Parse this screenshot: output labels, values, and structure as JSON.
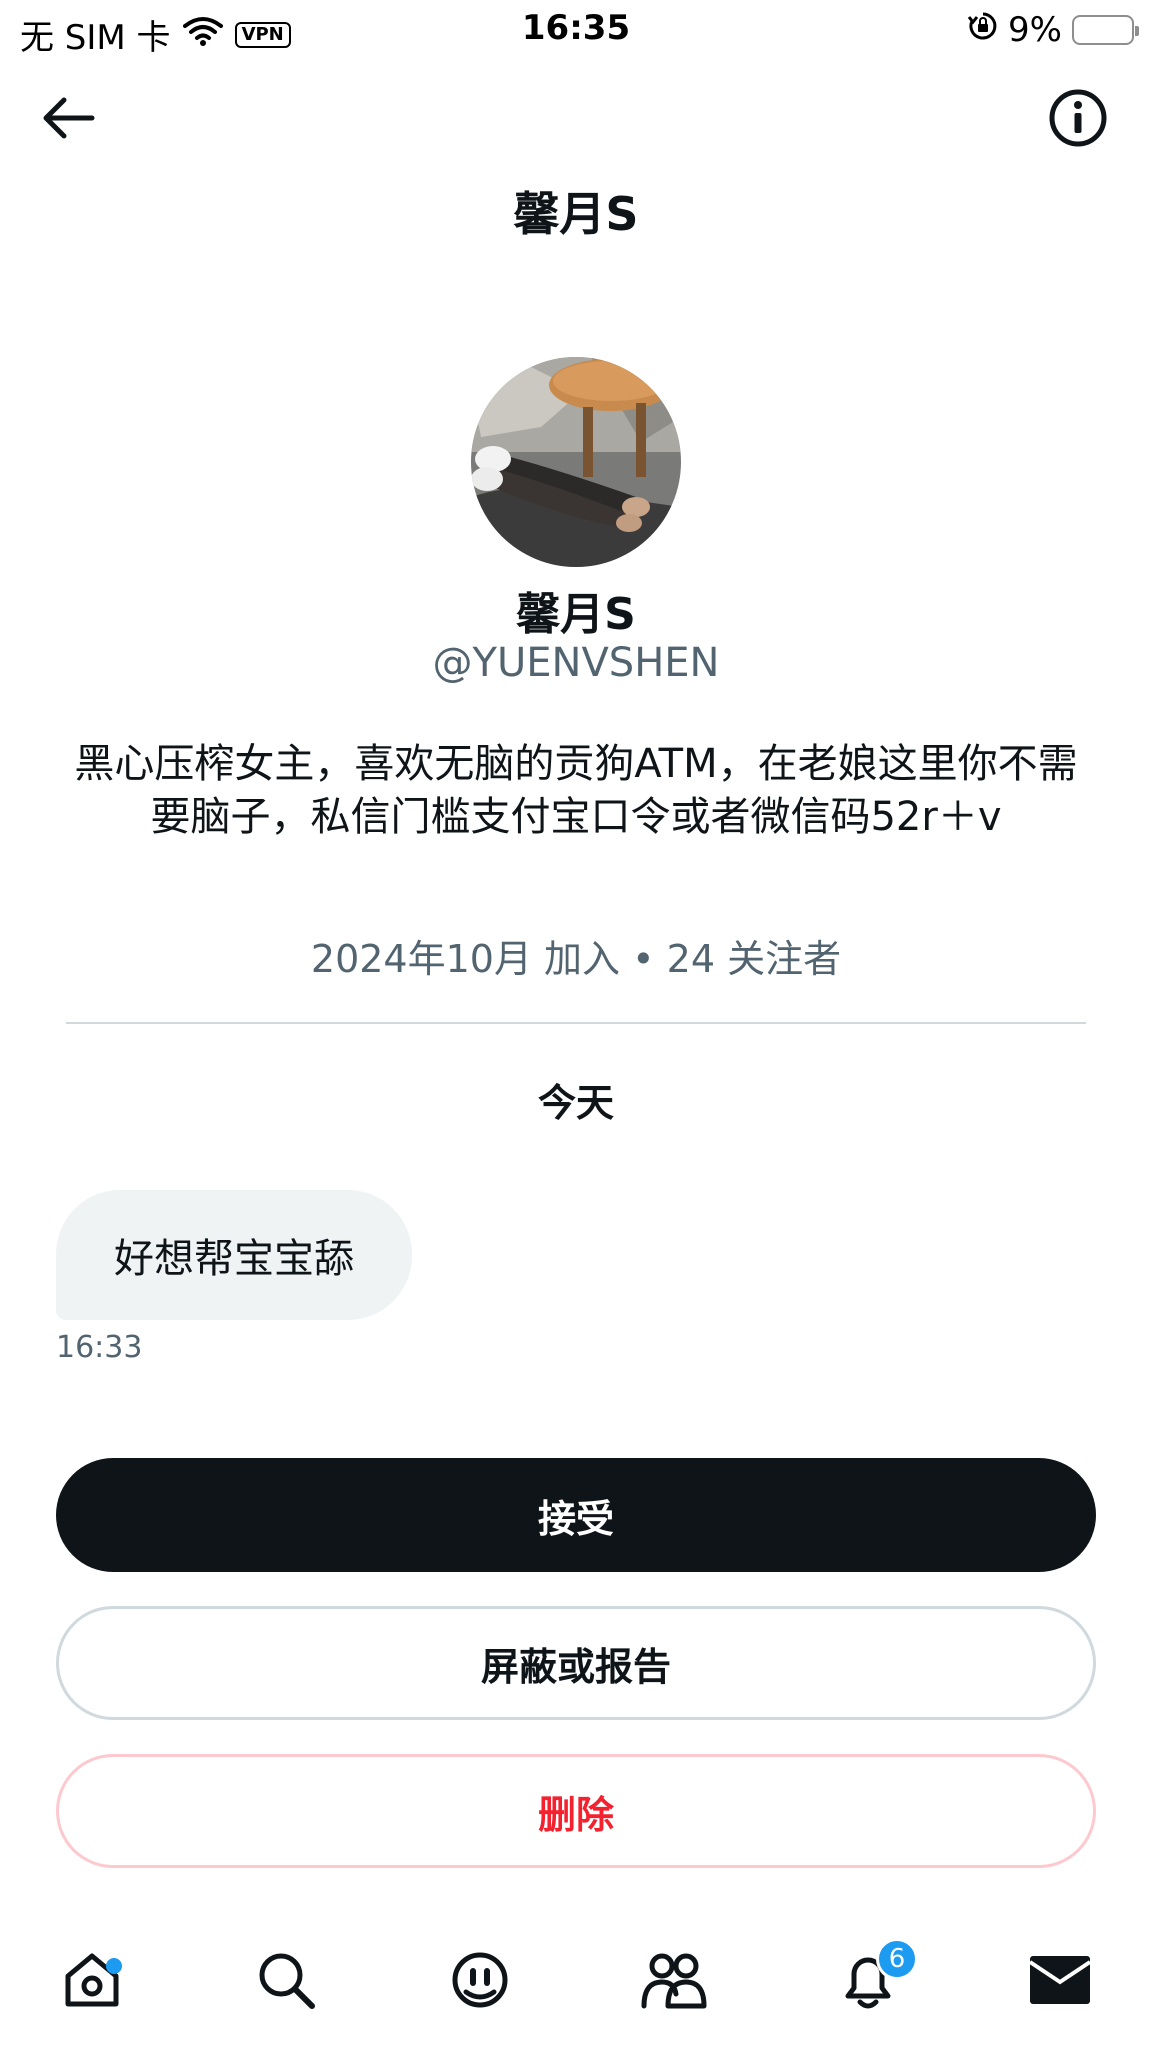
{
  "status_bar": {
    "carrier": "无 SIM 卡",
    "vpn": "VPN",
    "time": "16:35",
    "battery_percent": "9%",
    "battery_level": 0.09,
    "icons": [
      "wifi-icon",
      "vpn-icon",
      "orientation-lock-icon",
      "battery-icon"
    ]
  },
  "header": {
    "title": "馨月S",
    "back_icon": "arrow-left-icon",
    "info_icon": "info-icon"
  },
  "profile": {
    "name": "馨月S",
    "handle": "@YUENVSHEN",
    "bio": "黑心压榨女主，喜欢无脑的贡狗ATM，在老娘这里你不需要脑子，私信门槛支付宝口令或者微信码52r＋v",
    "joined": "2024年10月 加入",
    "separator": "•",
    "followers": "24 关注者"
  },
  "conversation": {
    "date_label": "今天",
    "messages": [
      {
        "text": "好想帮宝宝舔",
        "time": "16:33"
      }
    ]
  },
  "actions": {
    "accept": "接受",
    "block_or_report": "屏蔽或报告",
    "delete": "删除"
  },
  "tab_bar": {
    "tabs": [
      {
        "name": "home-icon",
        "has_dot": true
      },
      {
        "name": "search-icon"
      },
      {
        "name": "grok-icon"
      },
      {
        "name": "communities-icon"
      },
      {
        "name": "notifications-icon",
        "badge": "6"
      },
      {
        "name": "messages-icon",
        "active": true
      }
    ]
  },
  "colors": {
    "text_primary": "#0f1419",
    "text_secondary": "#536471",
    "accent_blue": "#1d9bf0",
    "danger_red": "#f4212e",
    "bubble_bg": "#eff3f4"
  }
}
